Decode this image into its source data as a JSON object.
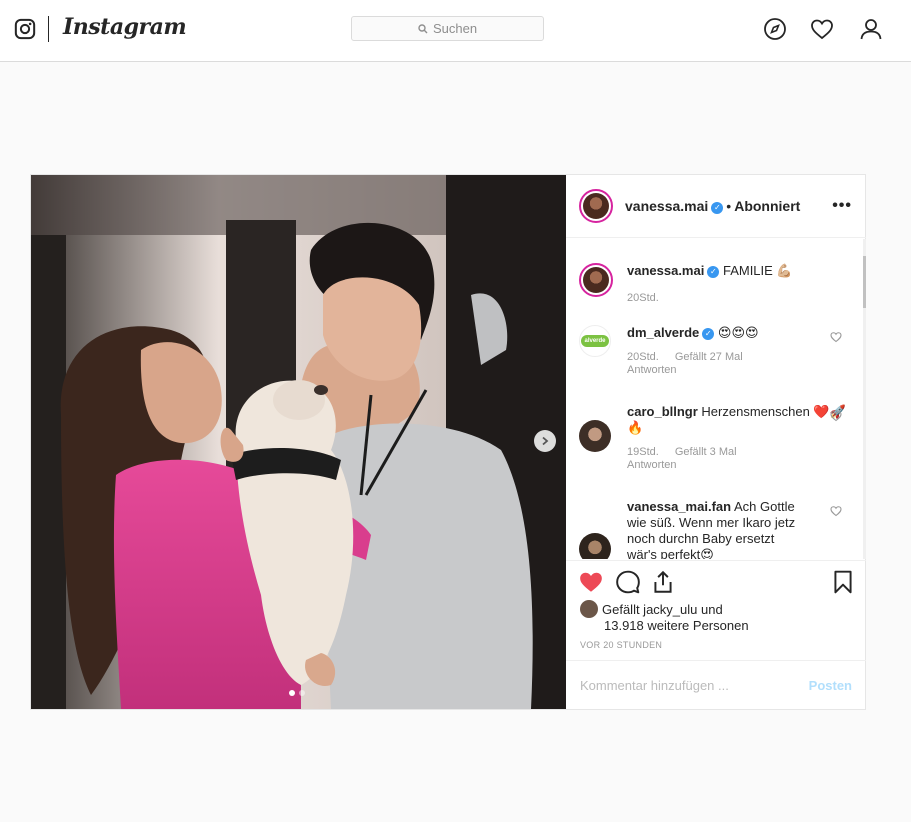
{
  "header": {
    "brand": "Instagram",
    "search_placeholder": "Suchen",
    "icons": [
      "instagram-glyph-icon",
      "explore-compass-icon",
      "activity-heart-icon",
      "profile-icon"
    ]
  },
  "post": {
    "author": "vanessa.mai",
    "follow_state": "Abonniert",
    "carousel": {
      "current": 1,
      "total": 2
    },
    "caption": {
      "user": "vanessa.mai",
      "text": "FAMILIE 💪🏼",
      "time": "20Std."
    },
    "comments": [
      {
        "user": "dm_alverde",
        "verified": true,
        "text": "😍😍😍",
        "time": "20Std.",
        "likes": "Gefällt 27 Mal",
        "reply": "Antworten",
        "avatar_text": "alverde"
      },
      {
        "user": "caro_bllngr",
        "verified": false,
        "text": "Herzensmenschen ❤️🚀🔥",
        "time": "19Std.",
        "likes": "Gefällt 3 Mal",
        "reply": "Antworten"
      },
      {
        "user": "vanessa_mai.fan",
        "verified": false,
        "text": "Ach Gottle wie süß. Wenn mer Ikaro jetz noch durchn Baby ersetzt wär's perfekt😍",
        "time": "",
        "likes": "",
        "reply": ""
      }
    ],
    "liked_by": {
      "line1": "Gefällt jacky_ulu und",
      "line2": "13.918 weitere Personen"
    },
    "timestamp": "VOR 20 STUNDEN",
    "comment_placeholder": "Kommentar hinzufügen ...",
    "post_button": "Posten",
    "liked": true
  },
  "colors": {
    "like_red": "#ed4956",
    "verified_blue": "#3897f0",
    "post_button_disabled": "#b2dffc"
  }
}
